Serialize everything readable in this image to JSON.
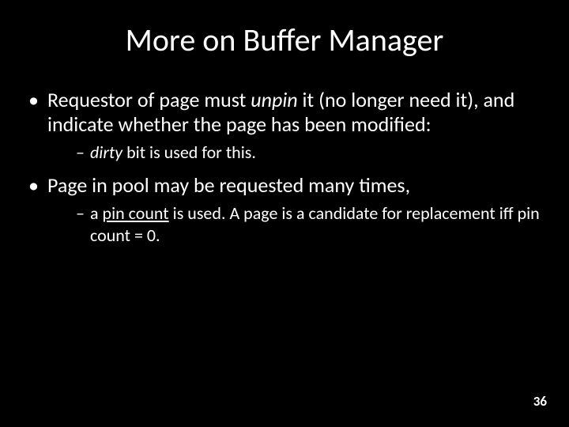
{
  "title": "More on Buffer Manager",
  "bullets": [
    {
      "parts": [
        {
          "t": "Requestor of page must "
        },
        {
          "t": "unpin",
          "cls": "italic"
        },
        {
          "t": " it (no longer need it), and indicate whether the page has been modified:"
        }
      ],
      "sub": [
        {
          "parts": [
            {
              "t": "dirty",
              "cls": "italic"
            },
            {
              "t": " bit is used for this."
            }
          ]
        }
      ]
    },
    {
      "parts": [
        {
          "t": "Page in pool may be requested many times,"
        }
      ],
      "sub": [
        {
          "parts": [
            {
              "t": "a "
            },
            {
              "t": "pin count",
              "cls": "under"
            },
            {
              "t": " is used.  A page is a candidate for replacement iff pin count = 0."
            }
          ]
        }
      ]
    }
  ],
  "page_number": "36"
}
